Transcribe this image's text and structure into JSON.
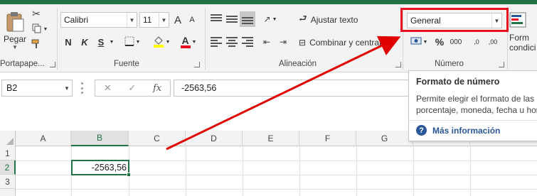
{
  "ribbon": {
    "clipboard": {
      "paste_label": "Pegar",
      "group_label": "Portapape..."
    },
    "font": {
      "font_name": "Calibri",
      "font_size": "11",
      "bold": "N",
      "italic": "K",
      "underline": "S",
      "grow": "A",
      "shrink": "A",
      "font_color_letter": "A",
      "group_label": "Fuente"
    },
    "alignment": {
      "wrap_text": "Ajustar texto",
      "merge_center": "Combinar y centrar",
      "group_label": "Alineación"
    },
    "number": {
      "format_value": "General",
      "percent": "%",
      "thousands": "000",
      "dec_increase": ",0",
      "dec_decrease": ",00",
      "group_label": "Número"
    },
    "styles": {
      "conditional_label_1": "Form",
      "conditional_label_2": "condici"
    }
  },
  "formula_bar": {
    "name_box": "B2",
    "fx": "fx",
    "cancel": "✕",
    "enter": "✓",
    "value": "-2563,56"
  },
  "tooltip": {
    "title": "Formato de número",
    "body_line_1": "Permite elegir el formato de las c",
    "body_line_2": "porcentaje, moneda, fecha u hor",
    "link": "Más información",
    "help_glyph": "?"
  },
  "grid": {
    "columns": [
      "A",
      "B",
      "C",
      "D",
      "E",
      "F",
      "G"
    ],
    "rows": [
      "1",
      "2",
      "3"
    ],
    "active_column": "B",
    "active_row": "2",
    "cell_b2": "-2563,56"
  },
  "colors": {
    "excel_green": "#217346",
    "highlight_red": "#e81123",
    "arrow_red": "#e00000"
  }
}
